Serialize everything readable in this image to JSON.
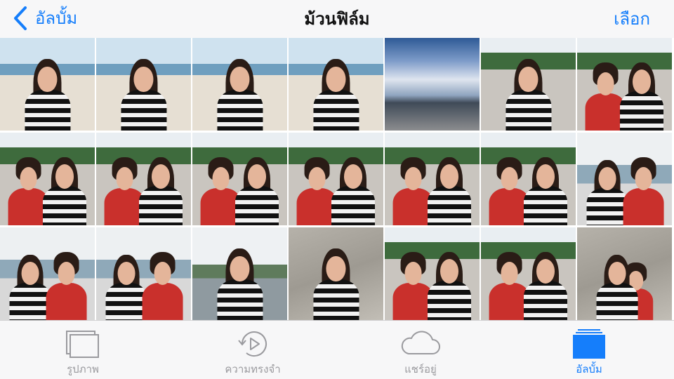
{
  "nav": {
    "back_label": "อัลบั้ม",
    "title": "ม้วนฟิล์ม",
    "select_label": "เลือก"
  },
  "photos": [
    {
      "scene": "beach",
      "people": "woman-stripes"
    },
    {
      "scene": "beach",
      "people": "woman-stripes"
    },
    {
      "scene": "beach",
      "people": "woman-stripes"
    },
    {
      "scene": "beach",
      "people": "woman-stripes"
    },
    {
      "scene": "sunset-sky",
      "people": "none"
    },
    {
      "scene": "park",
      "people": "woman-stripes"
    },
    {
      "scene": "park",
      "people": "couple"
    },
    {
      "scene": "park",
      "people": "couple"
    },
    {
      "scene": "park",
      "people": "couple"
    },
    {
      "scene": "park",
      "people": "couple"
    },
    {
      "scene": "park",
      "people": "couple"
    },
    {
      "scene": "park",
      "people": "couple"
    },
    {
      "scene": "park",
      "people": "couple"
    },
    {
      "scene": "sea",
      "people": "couple-reversed"
    },
    {
      "scene": "sea",
      "people": "couple-reversed"
    },
    {
      "scene": "sea",
      "people": "couple-reversed"
    },
    {
      "scene": "rocks",
      "people": "woman-stripes"
    },
    {
      "scene": "pier",
      "people": "woman-stripes"
    },
    {
      "scene": "park",
      "people": "couple"
    },
    {
      "scene": "park",
      "people": "couple"
    },
    {
      "scene": "pier",
      "people": "couple-stacked"
    }
  ],
  "tabs": [
    {
      "label": "รูปภาพ",
      "icon": "photos-icon",
      "active": false
    },
    {
      "label": "ความทรงจำ",
      "icon": "memories-icon",
      "active": false
    },
    {
      "label": "แชร์อยู่",
      "icon": "cloud-icon",
      "active": false
    },
    {
      "label": "อัลบั้ม",
      "icon": "albums-icon",
      "active": true
    }
  ],
  "colors": {
    "accent": "#157efb",
    "tab_inactive": "#9a9a9e",
    "bar_background": "#f7f7f8"
  }
}
